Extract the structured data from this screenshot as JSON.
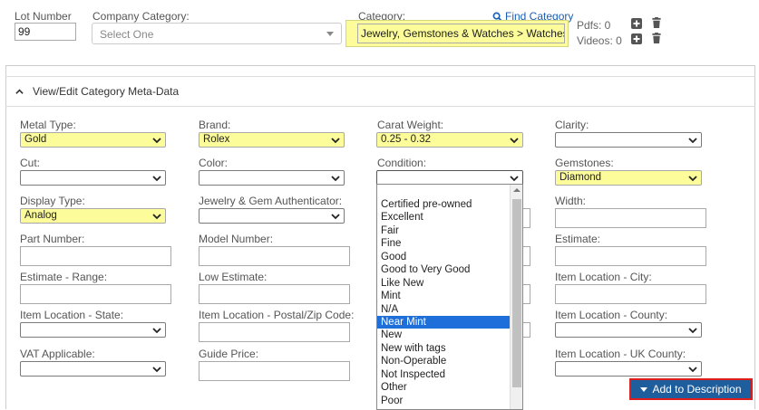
{
  "top": {
    "lot_number_label": "Lot Number",
    "lot_number_value": "99",
    "company_category_label": "Company Category:",
    "company_category_placeholder": "Select One",
    "category_label": "Category:",
    "find_category_label": "Find Category",
    "category_value": "Jewelry, Gemstones & Watches > Watches",
    "pdfs_label": "Pdfs: 0",
    "videos_label": "Videos: 0"
  },
  "panel": {
    "title": "View/Edit Category Meta-Data"
  },
  "fields": {
    "metal_type": {
      "label": "Metal Type:",
      "value": "Gold"
    },
    "brand": {
      "label": "Brand:",
      "value": "Rolex"
    },
    "carat_weight": {
      "label": "Carat Weight:",
      "value": "0.25 - 0.32"
    },
    "clarity": {
      "label": "Clarity:",
      "value": ""
    },
    "cut": {
      "label": "Cut:",
      "value": ""
    },
    "color": {
      "label": "Color:",
      "value": ""
    },
    "condition": {
      "label": "Condition:",
      "value": ""
    },
    "gemstones": {
      "label": "Gemstones:",
      "value": "Diamond"
    },
    "display_type": {
      "label": "Display Type:",
      "value": "Analog"
    },
    "authenticator": {
      "label": "Jewelry & Gem Authenticator:",
      "value": ""
    },
    "width": {
      "label": "Width:",
      "value": ""
    },
    "part_number": {
      "label": "Part Number:",
      "value": ""
    },
    "model_number": {
      "label": "Model Number:",
      "value": ""
    },
    "estimate": {
      "label": "Estimate:",
      "value": ""
    },
    "estimate_range": {
      "label": "Estimate - Range:",
      "value": ""
    },
    "low_estimate": {
      "label": "Low Estimate:",
      "value": ""
    },
    "item_city": {
      "label": "Item Location - City:",
      "value": ""
    },
    "item_state": {
      "label": "Item Location - State:",
      "value": ""
    },
    "item_postal": {
      "label": "Item Location - Postal/Zip Code:",
      "value": ""
    },
    "item_county": {
      "label": "Item Location - County:",
      "value": ""
    },
    "vat": {
      "label": "VAT Applicable:",
      "value": ""
    },
    "guide_price": {
      "label": "Guide Price:",
      "value": ""
    },
    "uk_county": {
      "label": "Item Location - UK County:",
      "value": ""
    }
  },
  "condition_options": [
    "Certified pre-owned",
    "Excellent",
    "Fair",
    "Fine",
    "Good",
    "Good to Very Good",
    "Like New",
    "Mint",
    "N/A",
    "Near Mint",
    "New",
    "New with tags",
    "Non-Operable",
    "Not Inspected",
    "Other",
    "Poor"
  ],
  "condition_highlighted": "Near Mint",
  "add_to_description_label": "Add to Description",
  "colors": {
    "highlight": "#fcfc9a",
    "primary_button": "#1f5e9c",
    "button_outline": "#e01d1d",
    "selected_option": "#1e6fd9",
    "link": "#1a5fb4"
  },
  "icons": [
    "search-icon",
    "plus-icon",
    "trash-icon",
    "chevron-up-icon",
    "chevron-down-icon",
    "caret-down-icon"
  ]
}
